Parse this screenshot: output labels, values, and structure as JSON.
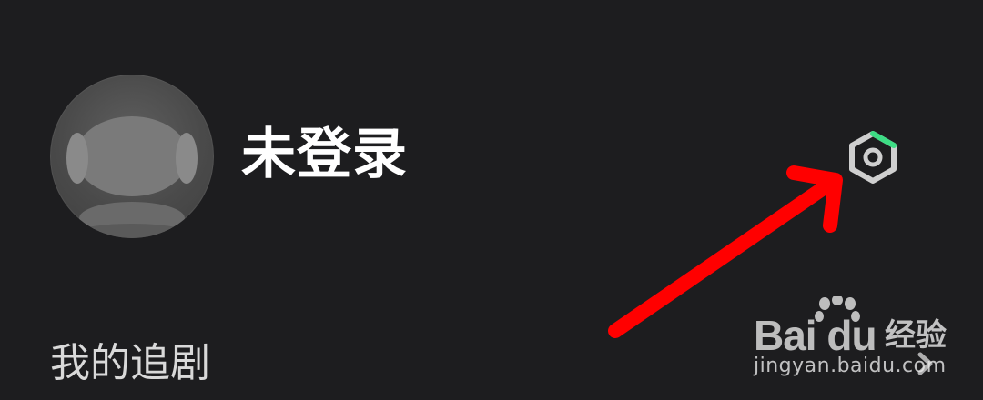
{
  "profile": {
    "name": "未登录"
  },
  "section": {
    "title": "我的追剧"
  },
  "icons": {
    "avatar": "avatar-placeholder-icon",
    "settings": "hex-settings-icon",
    "chevron": "chevron-right-icon"
  },
  "watermark": {
    "logo_text": "Bai du",
    "label": "经验",
    "url": "jingyan.baidu.com"
  },
  "colors": {
    "background": "#1d1d1f",
    "text_primary": "#ffffff",
    "text_secondary": "#d9d9d9",
    "annotation_arrow": "#ff0000",
    "settings_icon": "#cfcfcf",
    "settings_accent": "#3ddc84"
  }
}
